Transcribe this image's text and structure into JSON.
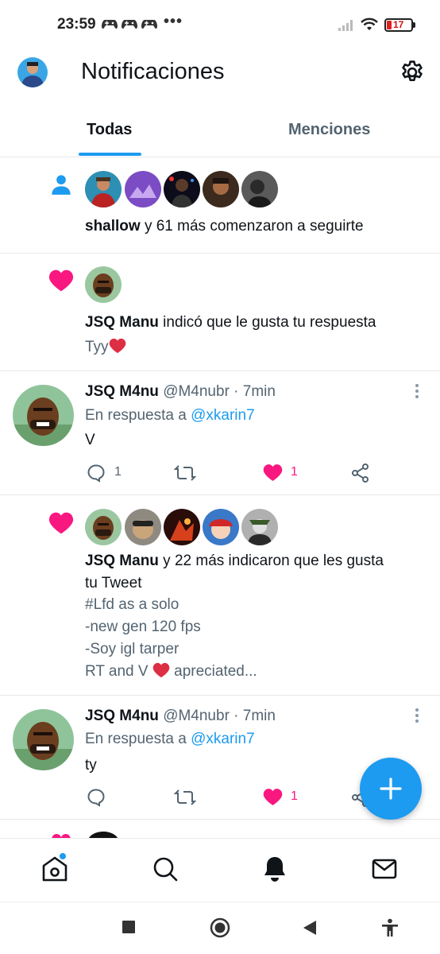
{
  "status_bar": {
    "time": "23:59",
    "dots": "•••",
    "battery_percent": "17",
    "icons": [
      "gamepad-icon",
      "gamepad-icon",
      "gamepad-icon",
      "signal-icon",
      "wifi-icon",
      "battery-icon"
    ]
  },
  "header": {
    "title": "Notificaciones",
    "settings_icon": "gear-icon"
  },
  "tabs": [
    {
      "label": "Todas",
      "active": true
    },
    {
      "label": "Menciones",
      "active": false
    }
  ],
  "notifications": [
    {
      "type": "follow",
      "icon": "person-icon",
      "actor": "shallow",
      "text": " y 61 más comenzaron a seguirte"
    },
    {
      "type": "like",
      "icon": "heart-icon",
      "actor": "JSQ Manu",
      "text": " indicó que le gusta tu respuesta",
      "snippet": "Tyy"
    },
    {
      "type": "reply",
      "name": "JSQ M4nu",
      "handle": "@M4nubr",
      "time": " · 7min",
      "reply_prefix": "En respuesta a ",
      "reply_to": "@xkarin7",
      "body": "V",
      "reply_count": "1",
      "like_count": "1"
    },
    {
      "type": "like",
      "icon": "heart-icon",
      "actor": "JSQ Manu",
      "text": " y 22 más indicaron que les gusta",
      "text2": "tu Tweet",
      "lines": [
        "#Lfd as a solo",
        "-new gen 120 fps",
        "-Soy igl tarper"
      ],
      "last_line_a": "RT and V ",
      "last_line_b": " apreciated..."
    },
    {
      "type": "reply",
      "name": "JSQ M4nu",
      "handle": "@M4nubr",
      "time": " · 7min",
      "reply_prefix": "En respuesta a ",
      "reply_to": "@xkarin7",
      "body": "ty",
      "like_count": "1"
    }
  ],
  "fab": {
    "icon": "plus-icon"
  },
  "bottom_nav": [
    "home-icon",
    "search-icon",
    "bell-icon",
    "mail-icon"
  ],
  "system_nav": [
    "recents-icon",
    "home-circle-icon",
    "back-icon",
    "accessibility-icon"
  ],
  "colors": {
    "accent": "#1d9bf0",
    "like": "#f91880",
    "text": "#0f1419",
    "secondary": "#536471"
  }
}
